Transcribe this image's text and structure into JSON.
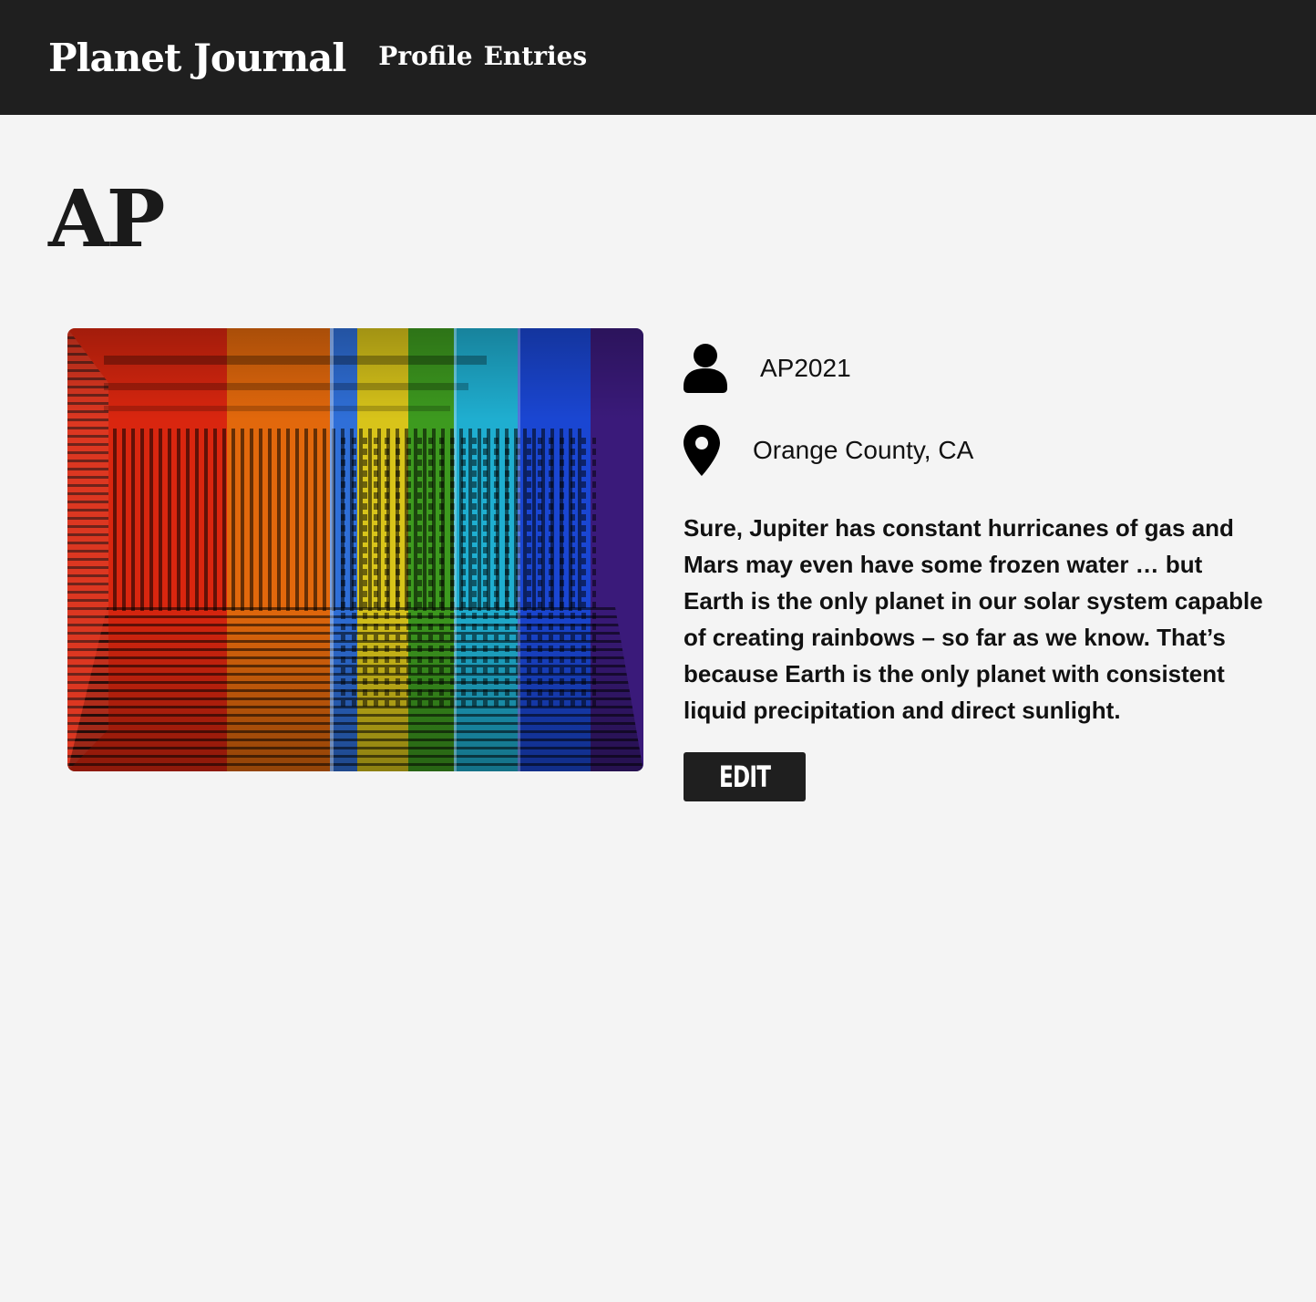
{
  "header": {
    "brand": "Planet Journal",
    "nav": [
      {
        "label": "Profile"
      },
      {
        "label": "Entries"
      }
    ]
  },
  "profile": {
    "title": "AP",
    "username": "AP2021",
    "location": "Orange County, CA",
    "bio": "Sure, Jupiter has constant hurricanes of gas and Mars may even have some frozen water … but Earth is the only planet in our solar system capable of creating rainbows – so far as we know. That’s because Earth is the only planet with consistent liquid precipitation and direct sunlight.",
    "edit_label": "Edit"
  },
  "icons": {
    "user": "user-icon",
    "location": "map-pin-icon"
  },
  "colors": {
    "header_bg": "#1f1f1f",
    "page_bg": "#f4f4f4",
    "button_bg": "#1f1f1f"
  }
}
